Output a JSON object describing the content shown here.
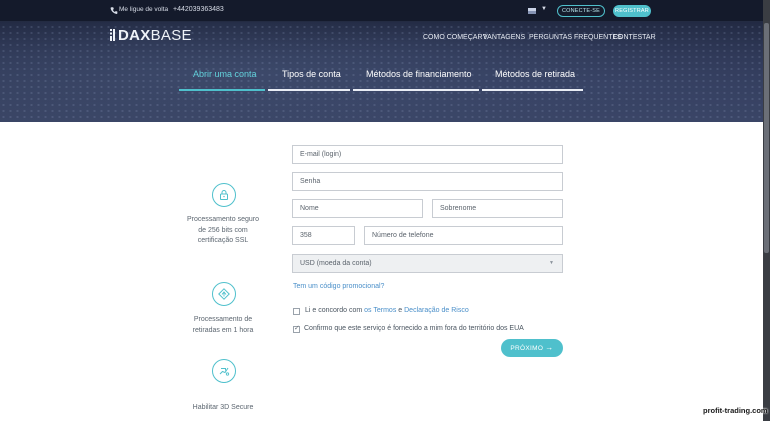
{
  "topbar": {
    "callback_label": "Me ligue de volta",
    "phone": "+442039363483",
    "login_label": "CONECTE-SE",
    "register_label": "REGISTRAR"
  },
  "brand": {
    "logo_prefix": "DAX",
    "logo_suffix": "BASE"
  },
  "nav": [
    "COMO COMEÇAR?",
    "VANTAGENS",
    "PERGUNTAS FREQUENTES",
    "CONTESTAR"
  ],
  "tabs": [
    "Abrir uma conta",
    "Tipos de conta",
    "Métodos de financiamento",
    "Métodos de retirada"
  ],
  "features": [
    {
      "icon": "lock-icon",
      "text": "Processamento seguro de 256 bits com certificação SSL"
    },
    {
      "icon": "withdrawal-icon",
      "text": "Processamento de retiradas em 1 hora"
    },
    {
      "icon": "3d-secure-icon",
      "text": "Habilitar 3D Secure"
    }
  ],
  "form": {
    "email": "E-mail (login)",
    "password": "Senha",
    "first_name": "Nome",
    "last_name": "Sobrenome",
    "country_code": "358",
    "phone": "Número de telefone",
    "currency": "USD (moeda da conta)",
    "promo_link": "Tem um código promocional?",
    "agree_prefix": "Li e concordo com ",
    "agree_terms": "os Termos",
    "agree_and": " e ",
    "agree_risk": "Declaração de Risco",
    "confirm_label": "Confirmo que este serviço é fornecido a mim fora do território dos EUA",
    "next_label": "PRÓXIMO",
    "next_arrow": "→"
  },
  "watermark": "profit-trading.com",
  "colors": {
    "accent": "#4fc0cc",
    "link": "#4a8fc9",
    "header_dark": "#141a2b"
  }
}
